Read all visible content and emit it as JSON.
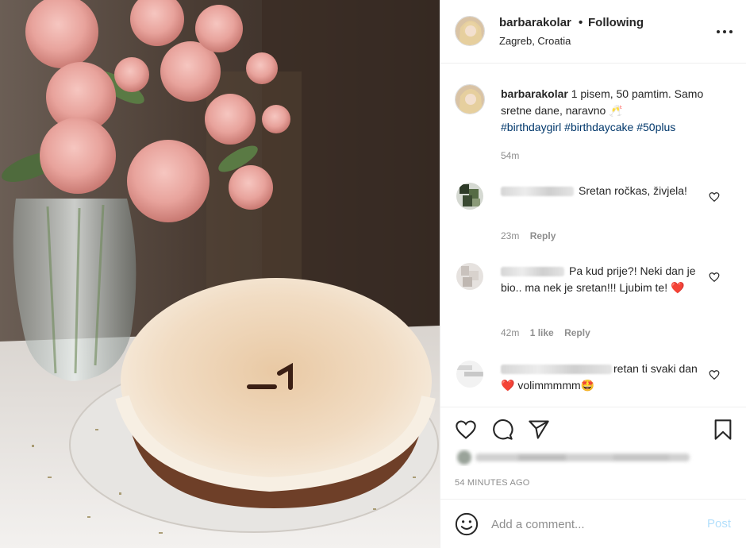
{
  "header": {
    "username": "barbarakolar",
    "separator": "•",
    "follow_status": "Following",
    "location": "Zagreb, Croatia",
    "more_icon": "more-horizontal-icon"
  },
  "caption": {
    "username": "barbarakolar",
    "text": "1 pisem, 50 pamtim. Samo sretne dane, naravno",
    "emoji": "🥂",
    "hashtags": [
      "#birthdaygirl",
      "#birthdaycake",
      "#50plus"
    ],
    "time": "54m"
  },
  "comments": [
    {
      "text": "Sretan ročkas, živjela!",
      "time": "23m",
      "likes": "",
      "reply": "Reply"
    },
    {
      "text": "Pa kud prije?! Neki dan je bio.. ma nek je sretan!!! Ljubim te!",
      "emoji": "❤️",
      "time": "42m",
      "likes": "1 like",
      "reply": "Reply"
    },
    {
      "text_a": "retan ti svaki dan",
      "emoji_a": "❤️",
      "text_b": "volimmmmm",
      "emoji_b": "🤩"
    }
  ],
  "actions": {
    "icons": [
      "heart-icon",
      "comment-icon",
      "share-icon",
      "bookmark-icon"
    ],
    "timestamp": "54 MINUTES AGO"
  },
  "add_comment": {
    "placeholder": "Add a comment...",
    "post_label": "Post"
  },
  "colors": {
    "hashtag": "#00376b",
    "muted": "#8e8e8e",
    "post_disabled": "#b2dffc",
    "heart": "#ed4956",
    "divider": "#efefef"
  }
}
